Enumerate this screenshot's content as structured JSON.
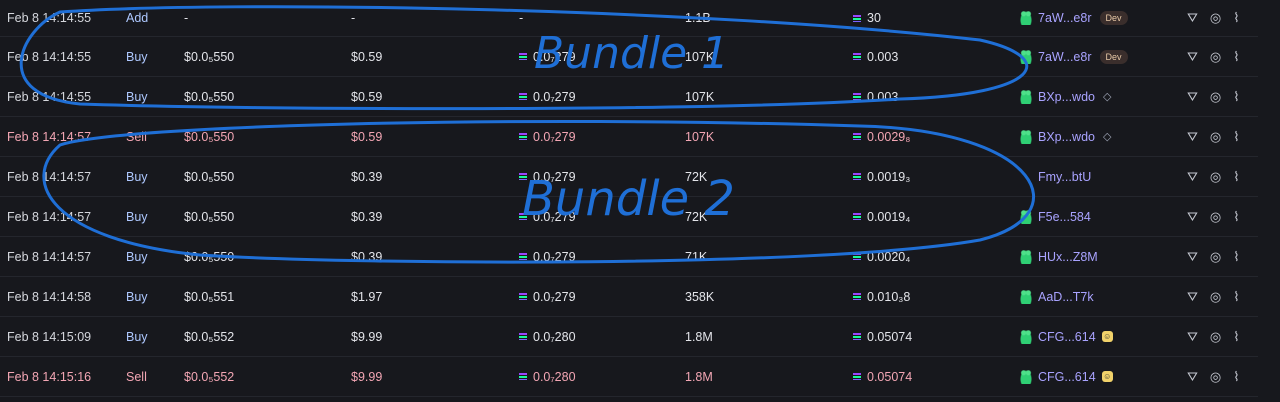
{
  "rows": [
    {
      "date": "Feb 8 14:14:55",
      "type": "Add",
      "kind": "add",
      "price": "-",
      "total": "-",
      "sol": "-",
      "amount": "1.1B",
      "sol2": "30",
      "maker": "7aW...e8r",
      "badge": "Dev",
      "icon": "frog"
    },
    {
      "date": "Feb 8 14:14:55",
      "type": "Buy",
      "kind": "buy",
      "price": "$0.0₅550",
      "total": "$0.59",
      "sol": "0.0₇279",
      "amount": "107K",
      "sol2": "0.003",
      "maker": "7aW...e8r",
      "badge": "Dev",
      "icon": "frog"
    },
    {
      "date": "Feb 8 14:14:55",
      "type": "Buy",
      "kind": "buy",
      "price": "$0.0₅550",
      "total": "$0.59",
      "sol": "0.0₇279",
      "amount": "107K",
      "sol2": "0.003",
      "maker": "BXp...wdo",
      "badge": "◇",
      "icon": "frog"
    },
    {
      "date": "Feb 8 14:14:57",
      "type": "Sell",
      "kind": "sell",
      "price": "$0.0₅550",
      "total": "$0.59",
      "sol": "0.0₇279",
      "amount": "107K",
      "sol2": "0.0029₈",
      "maker": "BXp...wdo",
      "badge": "◇",
      "icon": "frog"
    },
    {
      "date": "Feb 8 14:14:57",
      "type": "Buy",
      "kind": "buy",
      "price": "$0.0₅550",
      "total": "$0.39",
      "sol": "0.0₇279",
      "amount": "72K",
      "sol2": "0.0019₃",
      "maker": "Fmy...btU",
      "badge": "",
      "icon": ""
    },
    {
      "date": "Feb 8 14:14:57",
      "type": "Buy",
      "kind": "buy",
      "price": "$0.0₅550",
      "total": "$0.39",
      "sol": "0.0₇279",
      "amount": "72K",
      "sol2": "0.0019₄",
      "maker": "F5e...584",
      "badge": "",
      "icon": "frog"
    },
    {
      "date": "Feb 8 14:14:57",
      "type": "Buy",
      "kind": "buy",
      "price": "$0.0₅550",
      "total": "$0.39",
      "sol": "0.0₇279",
      "amount": "71K",
      "sol2": "0.0020₄",
      "maker": "HUx...Z8M",
      "badge": "",
      "icon": "frog"
    },
    {
      "date": "Feb 8 14:14:58",
      "type": "Buy",
      "kind": "buy",
      "price": "$0.0₅551",
      "total": "$1.97",
      "sol": "0.0₇279",
      "amount": "358K",
      "sol2": "0.010₃8",
      "maker": "AaD...T7k",
      "badge": "",
      "icon": "frog"
    },
    {
      "date": "Feb 8 14:15:09",
      "type": "Buy",
      "kind": "buy",
      "price": "$0.0₅552",
      "total": "$9.99",
      "sol": "0.0₇280",
      "amount": "1.8M",
      "sol2": "0.05074",
      "maker": "CFG...614",
      "badge": "☺",
      "icon": "frog"
    },
    {
      "date": "Feb 8 14:15:16",
      "type": "Sell",
      "kind": "sell",
      "price": "$0.0₅552",
      "total": "$9.99",
      "sol": "0.0₇280",
      "amount": "1.8M",
      "sol2": "0.05074",
      "maker": "CFG...614",
      "badge": "☺",
      "icon": "frog"
    }
  ],
  "annotations": {
    "bundle1": "Bundle 1",
    "bundle2": "Bundle 2",
    "color": "#1f6fd6"
  }
}
